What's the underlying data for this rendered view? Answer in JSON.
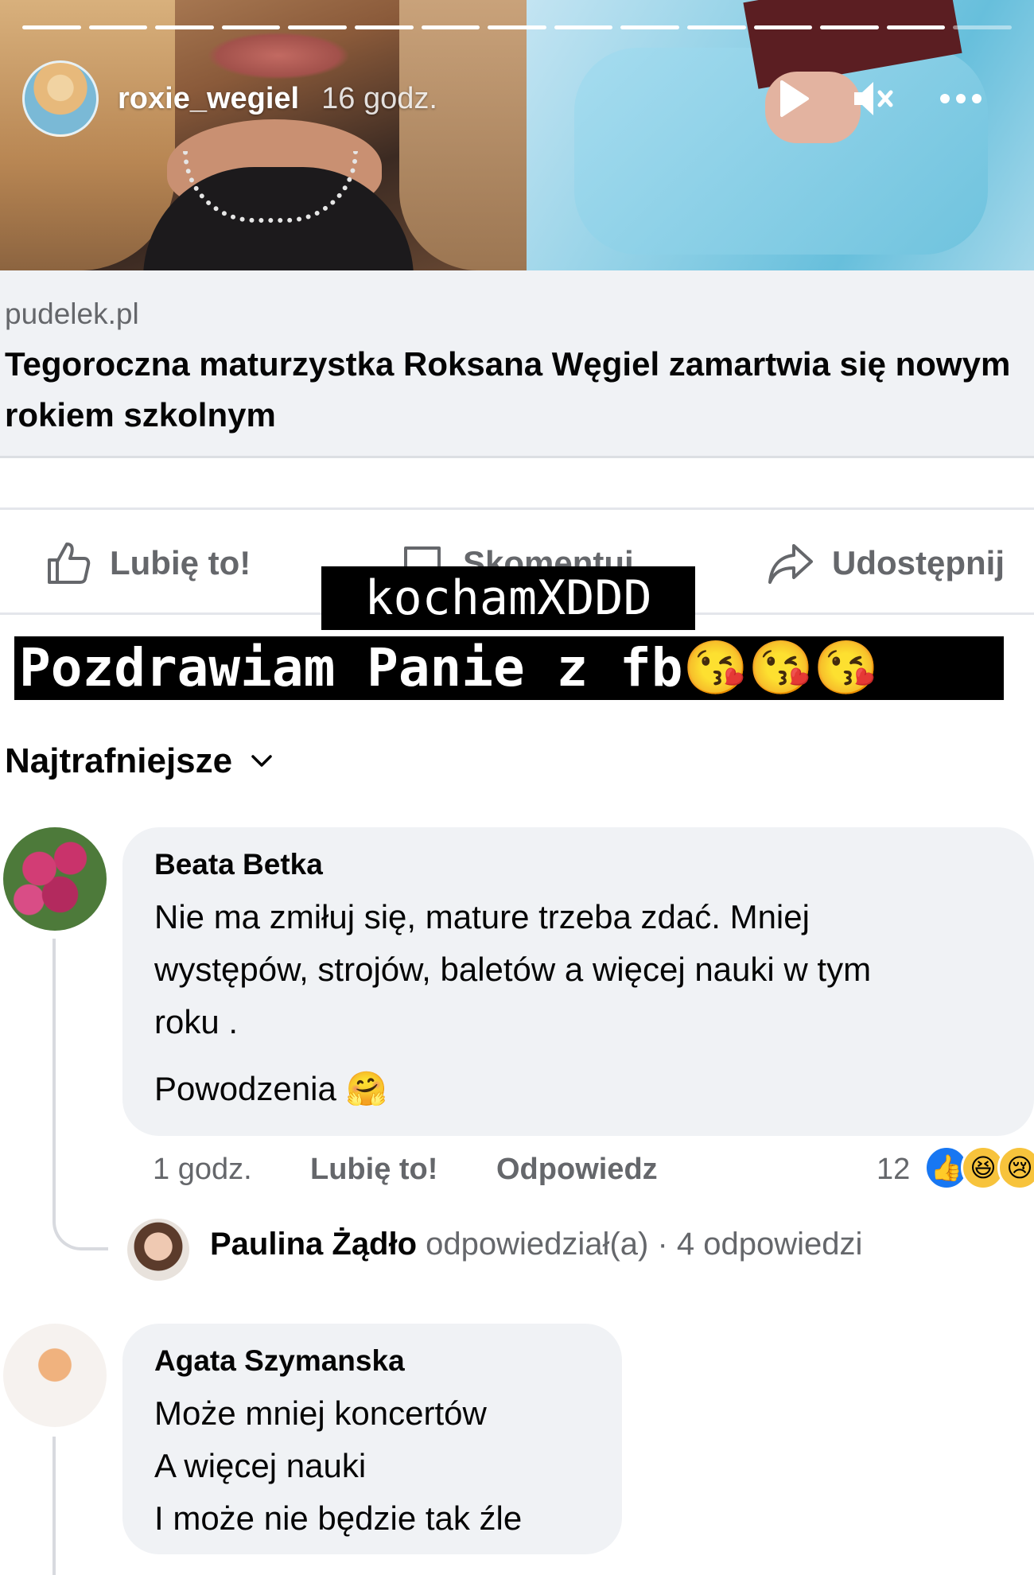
{
  "story": {
    "username": "roxie_wegiel",
    "time": "16 godz.",
    "progress_total": 15,
    "progress_done": 14,
    "controls": [
      "play-icon",
      "mute-icon",
      "more-icon"
    ]
  },
  "link_preview": {
    "domain": "pudelek.pl",
    "title": "Tegoroczna maturzystka Roksana Węgiel zamartwia się nowym rokiem szkolnym"
  },
  "actions": {
    "like": "Lubię to!",
    "comment": "Skomentuj",
    "share": "Udostępnij"
  },
  "stickers": {
    "line1": "kochamXDDD",
    "line2": "Pozdrawiam Panie z fb😘😘😘"
  },
  "sort": {
    "label": "Najtrafniejsze"
  },
  "comments": [
    {
      "author": "Beata Betka",
      "lines": [
        "Nie ma zmiłuj się, mature trzeba zdać. Mniej",
        "występów, strojów, baletów a więcej nauki w tym",
        "roku ."
      ],
      "extra": "Powodzenia 🤗",
      "time": "1 godz.",
      "like_label": "Lubię to!",
      "reply_label": "Odpowiedz",
      "reaction_count": "12",
      "replies": {
        "name": "Paulina Żądło",
        "action": "odpowiedział(a)",
        "count": "· 4 odpowiedzi"
      }
    },
    {
      "author": "Agata Szymanska",
      "lines": [
        "Może mniej koncertów",
        "A więcej nauki",
        "I może nie będzie tak źle"
      ]
    }
  ],
  "colors": {
    "fb_blue": "#1877f2",
    "gray_text": "#65676b",
    "bubble_bg": "#f0f2f5"
  }
}
